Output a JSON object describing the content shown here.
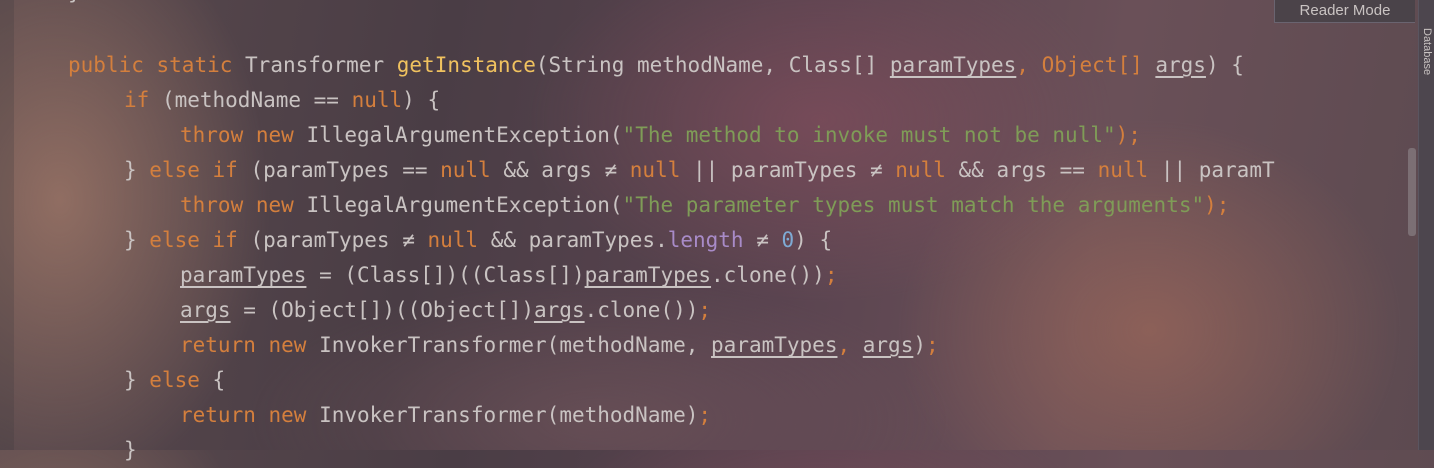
{
  "toolbar": {
    "reader_mode_label": "Reader Mode"
  },
  "side_panel": {
    "database_tab_label": "Database"
  },
  "code": {
    "top_brace": "}",
    "l1": {
      "public": "public",
      "static": "static",
      "type": "Transformer",
      "fname": "getInstance",
      "p1": "(String methodName, Class[] ",
      "paramTypes": "paramTypes",
      "p2": ", Object[] ",
      "args": "args",
      "p3": ") {"
    },
    "l2": {
      "if": "if",
      "a": " (methodName == ",
      "null": "null",
      "b": ") {"
    },
    "l3": {
      "throw": "throw",
      "new": "new",
      "a": " IllegalArgumentException(",
      "s": "\"The method to invoke must not be null\"",
      "b": ");"
    },
    "l4": {
      "a": "} ",
      "else": "else",
      "if": "if",
      "b": " (paramTypes == ",
      "null1": "null",
      "c": " && args ≠ ",
      "null2": "null",
      "d": " || paramTypes ≠ ",
      "null3": "null",
      "e": " && args == ",
      "null4": "null",
      "f": " || paramT"
    },
    "l5": {
      "throw": "throw",
      "new": "new",
      "a": " IllegalArgumentException(",
      "s": "\"The parameter types must match the arguments\"",
      "b": ");"
    },
    "l6": {
      "a": "} ",
      "else": "else",
      "if": "if",
      "b": " (paramTypes ≠ ",
      "null": "null",
      "c": " && paramTypes.",
      "length": "length",
      "d": " ≠ ",
      "zero": "0",
      "e": ") {"
    },
    "l7": {
      "var": "paramTypes",
      "a": " = (Class[])((Class[])",
      "var2": "paramTypes",
      "b": ".clone())",
      "semi": ";"
    },
    "l8": {
      "var": "args",
      "a": " = (Object[])((Object[])",
      "var2": "args",
      "b": ".clone())",
      "semi": ";"
    },
    "l9": {
      "return": "return",
      "new": "new",
      "a": " InvokerTransformer(methodName, ",
      "v1": "paramTypes",
      "b": ", ",
      "v2": "args",
      "c": ")",
      "semi": ";"
    },
    "l10": {
      "a": "} ",
      "else": "else",
      "b": " {"
    },
    "l11": {
      "return": "return",
      "new": "new",
      "a": " InvokerTransformer(methodName)",
      "semi": ";"
    },
    "l12": {
      "a": "}"
    }
  }
}
